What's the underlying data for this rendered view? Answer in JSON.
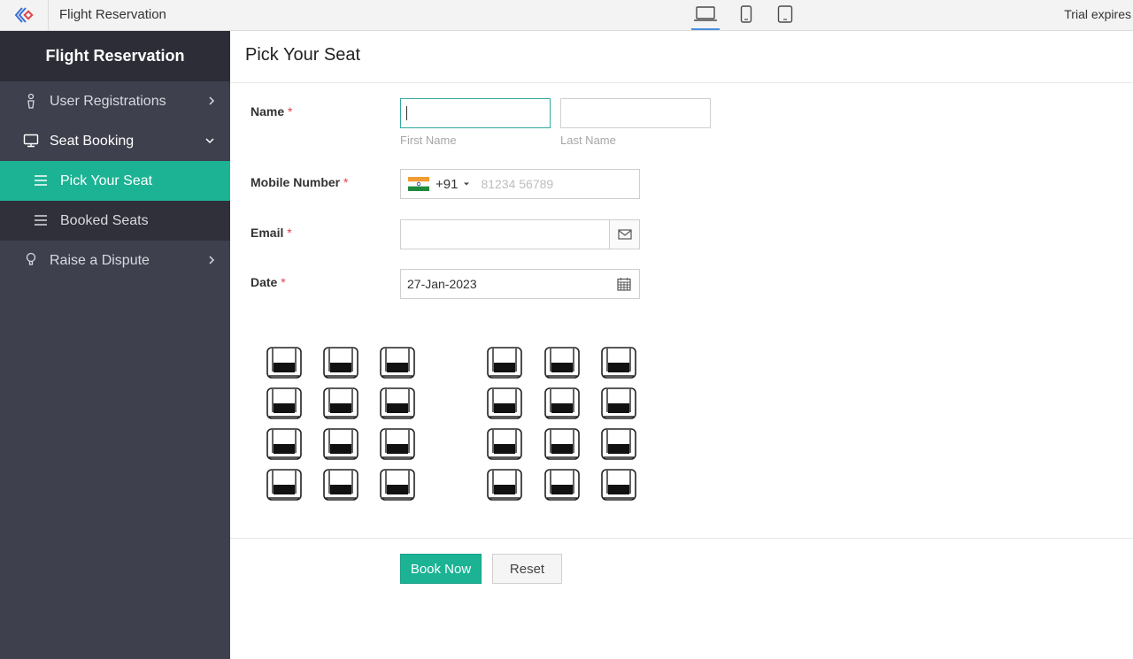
{
  "topbar": {
    "app_name": "Flight Reservation",
    "trial_text": "Trial expires",
    "devices": [
      {
        "icon": "laptop-icon",
        "active": true
      },
      {
        "icon": "mobile-icon",
        "active": false
      },
      {
        "icon": "tablet-icon",
        "active": false
      }
    ]
  },
  "sidebar": {
    "header": "Flight Reservation",
    "items": [
      {
        "label": "User Registrations",
        "icon": "person-icon",
        "chevron": "right"
      },
      {
        "label": "Seat Booking",
        "icon": "monitor-icon",
        "chevron": "down",
        "open": true,
        "children": [
          {
            "label": "Pick Your Seat",
            "icon": "list-icon",
            "active": true
          },
          {
            "label": "Booked Seats",
            "icon": "list-icon",
            "active": false
          }
        ]
      },
      {
        "label": "Raise a Dispute",
        "icon": "bulb-icon",
        "chevron": "right"
      }
    ]
  },
  "form": {
    "title": "Pick Your Seat",
    "name_label": "Name",
    "required_mark": "*",
    "first_name_value": "",
    "first_name_hint": "First Name",
    "last_name_value": "",
    "last_name_hint": "Last Name",
    "mobile_label": "Mobile Number",
    "country_code": "+91",
    "mobile_value": "",
    "mobile_placeholder": "81234 56789",
    "email_label": "Email",
    "email_value": "",
    "date_label": "Date",
    "date_value": "27-Jan-2023"
  },
  "seats": {
    "rows": 4,
    "left_columns": 3,
    "right_columns": 3,
    "icon": "seat-icon"
  },
  "buttons": {
    "book_now": "Book Now",
    "reset": "Reset"
  },
  "colors": {
    "accent": "#1bb394",
    "sidebar_bg": "#3e404d",
    "sidebar_header_bg": "#2c2d36",
    "required": "#e0424a"
  }
}
